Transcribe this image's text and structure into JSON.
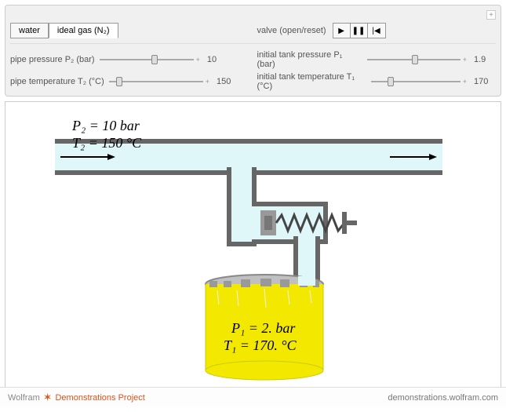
{
  "tabs": {
    "water": "water",
    "ideal_gas": "ideal gas (N₂)"
  },
  "valve_label": "valve (open/reset)",
  "controls": {
    "p2": {
      "label": "pipe pressure P₂ (bar)",
      "value": "10",
      "pos": 55
    },
    "t2": {
      "label": "pipe temperature T₂ (°C)",
      "value": "150",
      "pos": 8
    },
    "p1": {
      "label": "initial tank pressure P₁ (bar)",
      "value": "1.9",
      "pos": 48
    },
    "t1": {
      "label": "initial tank temperature T₁ (°C)",
      "value": "170",
      "pos": 18
    }
  },
  "diagram": {
    "p2_text": "P₂ = 10 bar",
    "t2_text": "T₂ = 150 °C",
    "p1_text": "P₁ = 2. bar",
    "t1_text": "T₁ = 170. °C"
  },
  "footer": {
    "brand": "Wolfram",
    "project": "Demonstrations Project",
    "url": "demonstrations.wolfram.com"
  }
}
